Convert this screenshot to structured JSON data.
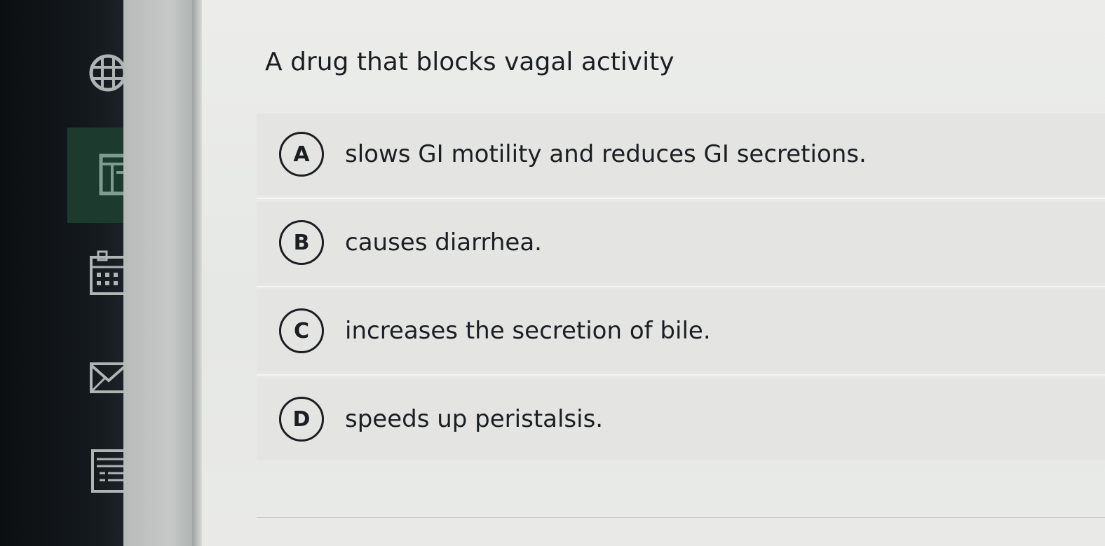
{
  "sidebar": {
    "items": [
      {
        "icon": "globe-icon",
        "active": false
      },
      {
        "icon": "page-layout-icon",
        "active": true
      },
      {
        "icon": "calendar-icon",
        "active": false
      },
      {
        "icon": "mail-icon",
        "active": false
      },
      {
        "icon": "document-list-icon",
        "active": false
      }
    ],
    "active_color": "#1d3a2f"
  },
  "question": {
    "text": "A drug that blocks vagal activity"
  },
  "options": [
    {
      "letter": "A",
      "text": "slows GI motility and reduces GI secretions."
    },
    {
      "letter": "B",
      "text": "causes diarrhea."
    },
    {
      "letter": "C",
      "text": "increases the secretion of bile."
    },
    {
      "letter": "D",
      "text": "speeds up peristalsis."
    }
  ]
}
